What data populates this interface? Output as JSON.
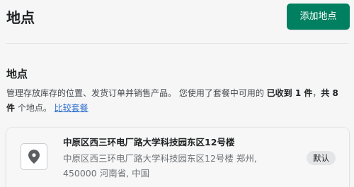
{
  "header": {
    "title": "地点",
    "add_button_label": "添加地点"
  },
  "section": {
    "title": "地点",
    "description_prefix": "管理存放库存的位置、发货订单并销售产品。 您使用了套餐中可用的 ",
    "used_count": "已收到 1 件",
    "description_mid": "，",
    "total_count": "共 8 件",
    "description_suffix": " 个地点。 ",
    "compare_link": "比较套餐"
  },
  "location": {
    "name": "中原区西三环电厂路大学科技园东区12号楼",
    "address_line1": "中原区西三环电厂路大学科技园东区12号楼 郑州,",
    "address_line2": "450000 河南省, 中国",
    "badge": "默认",
    "icon": "map-pin-icon"
  },
  "colors": {
    "primary": "#008060",
    "link": "#2c6ecb",
    "badge_bg": "#e4e5e7",
    "page_bg": "#f6f6f7"
  }
}
